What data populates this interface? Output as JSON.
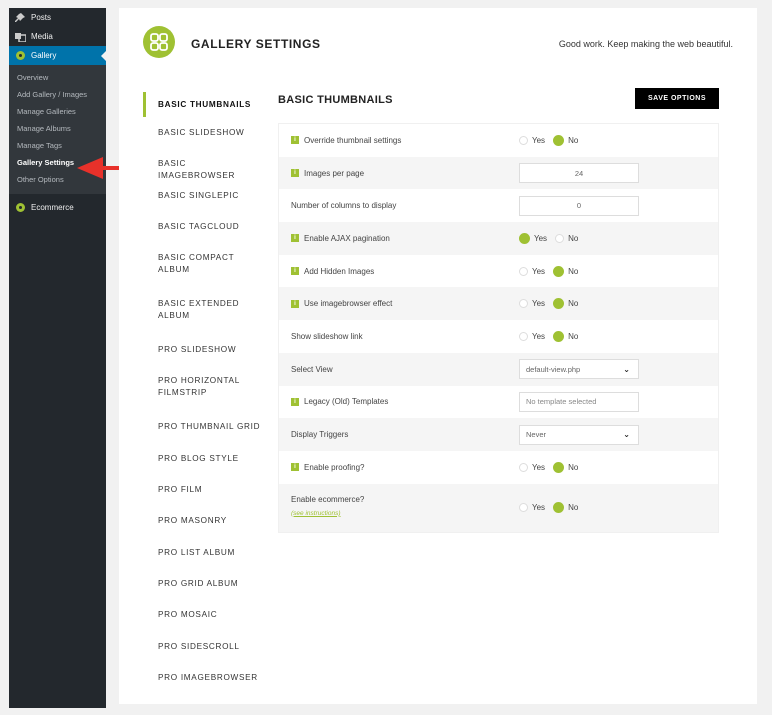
{
  "wp_menu": {
    "posts": "Posts",
    "media": "Media",
    "gallery": "Gallery",
    "submenu": [
      "Overview",
      "Add Gallery / Images",
      "Manage Galleries",
      "Manage Albums",
      "Manage Tags",
      "Gallery Settings",
      "Other Options"
    ],
    "ecommerce": "Ecommerce"
  },
  "header": {
    "title": "GALLERY SETTINGS",
    "tagline": "Good work. Keep making the web beautiful."
  },
  "tabs": [
    "BASIC THUMBNAILS",
    "BASIC SLIDESHOW",
    "BASIC IMAGEBROWSER",
    "BASIC SINGLEPIC",
    "BASIC TAGCLOUD",
    "BASIC COMPACT ALBUM",
    "BASIC EXTENDED ALBUM",
    "PRO SLIDESHOW",
    "PRO HORIZONTAL FILMSTRIP",
    "PRO THUMBNAIL GRID",
    "PRO BLOG STYLE",
    "PRO FILM",
    "PRO MASONRY",
    "PRO LIST ALBUM",
    "PRO GRID ALBUM",
    "PRO MOSAIC",
    "PRO SIDESCROLL",
    "PRO IMAGEBROWSER"
  ],
  "content": {
    "title": "BASIC THUMBNAILS",
    "save_label": "SAVE OPTIONS",
    "yes": "Yes",
    "no": "No",
    "see_instructions": "(see instructions)",
    "rows": {
      "override": "Override thumbnail settings",
      "images_per_page": "Images per page",
      "images_per_page_value": "24",
      "columns": "Number of columns to display",
      "columns_value": "0",
      "ajax": "Enable AJAX pagination",
      "hidden": "Add Hidden Images",
      "imagebrowser": "Use imagebrowser effect",
      "slideshow_link": "Show slideshow link",
      "select_view": "Select View",
      "select_view_value": "default-view.php",
      "legacy": "Legacy (Old) Templates",
      "legacy_placeholder": "No template selected",
      "triggers": "Display Triggers",
      "triggers_value": "Never",
      "proofing": "Enable proofing?",
      "ecommerce": "Enable ecommerce?"
    }
  },
  "colors": {
    "accent": "#9fc133",
    "wp_active": "#0073aa",
    "arrow": "#e8312a"
  }
}
